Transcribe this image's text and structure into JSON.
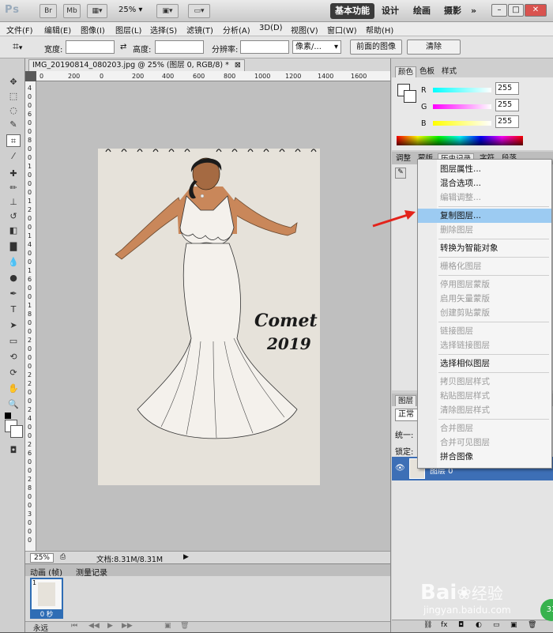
{
  "app": {
    "logo": "Ps",
    "launcher_br": "Br",
    "launcher_mb": "Mb",
    "zoom_select": "25%",
    "workspaces": [
      "基本功能",
      "设计",
      "绘画",
      "摄影"
    ],
    "more": "»"
  },
  "menu": [
    "文件(F)",
    "编辑(E)",
    "图像(I)",
    "图层(L)",
    "选择(S)",
    "滤镜(T)",
    "分析(A)",
    "3D(D)",
    "视图(V)",
    "窗口(W)",
    "帮助(H)"
  ],
  "options": {
    "width_label": "宽度:",
    "swap": "⇄",
    "height_label": "高度:",
    "resolution_label": "分辨率:",
    "unit_select": "像素/...",
    "front_image_button": "前面的图像",
    "clear_button": "清除"
  },
  "document": {
    "tab_title": "IMG_20190814_080203.jpg @ 25% (图层 0, RGB/8) *",
    "ruler_h": [
      "0",
      "200",
      "0",
      "200",
      "400",
      "600",
      "800",
      "1000",
      "1200",
      "1400",
      "1600"
    ],
    "ruler_v": [
      "4",
      "0",
      "0",
      "6",
      "0",
      "0",
      "8",
      "0",
      "0",
      "1",
      "0",
      "0",
      "0",
      "1",
      "2",
      "0",
      "0",
      "1",
      "4",
      "0",
      "0",
      "1",
      "6",
      "0",
      "0",
      "1",
      "8",
      "0",
      "0",
      "2",
      "0",
      "0",
      "0",
      "2",
      "2",
      "0",
      "0",
      "2",
      "4",
      "0",
      "0",
      "2",
      "6",
      "0",
      "0",
      "2",
      "8",
      "0",
      "0",
      "3",
      "0",
      "0",
      "0"
    ],
    "artwork_text_line1": "Comet",
    "artwork_text_line2": "2019",
    "status_zoom": "25%",
    "status_doc": "文档:8.31M/8.31M"
  },
  "animation": {
    "tabs": [
      "动画 (帧)",
      "测量记录"
    ],
    "frame_index": "1",
    "frame_delay": "0 秒",
    "loop": "永远"
  },
  "color_panel": {
    "tabs": [
      "颜色",
      "色板",
      "样式"
    ],
    "channels": [
      {
        "label": "R",
        "value": "255",
        "gradient": "#ff0000"
      },
      {
        "label": "G",
        "value": "255",
        "gradient": "#00ff00"
      },
      {
        "label": "B",
        "value": "255",
        "gradient": "#0000ff"
      }
    ]
  },
  "history_panel": {
    "tabs": [
      "调整",
      "蒙版",
      "历史记录",
      "字符",
      "段落"
    ]
  },
  "layers_panel": {
    "tabs": [
      "图层"
    ],
    "blend_mode": "正常",
    "unify_label": "统一:",
    "lock_label": "锁定:",
    "layer_name": "图层 0"
  },
  "context_menu": {
    "groups": [
      [
        {
          "label": "图层属性...",
          "enabled": true
        },
        {
          "label": "混合选项...",
          "enabled": true
        },
        {
          "label": "编辑调整...",
          "enabled": false
        }
      ],
      [
        {
          "label": "复制图层...",
          "enabled": true,
          "highlighted": true
        },
        {
          "label": "删除图层",
          "enabled": false
        }
      ],
      [
        {
          "label": "转换为智能对象",
          "enabled": true
        }
      ],
      [
        {
          "label": "栅格化图层",
          "enabled": false
        }
      ],
      [
        {
          "label": "停用图层蒙版",
          "enabled": false
        },
        {
          "label": "启用矢量蒙版",
          "enabled": false
        },
        {
          "label": "创建剪贴蒙版",
          "enabled": false
        }
      ],
      [
        {
          "label": "链接图层",
          "enabled": false
        },
        {
          "label": "选择链接图层",
          "enabled": false
        }
      ],
      [
        {
          "label": "选择相似图层",
          "enabled": true
        }
      ],
      [
        {
          "label": "拷贝图层样式",
          "enabled": false
        },
        {
          "label": "粘贴图层样式",
          "enabled": false
        },
        {
          "label": "清除图层样式",
          "enabled": false
        }
      ],
      [
        {
          "label": "合并图层",
          "enabled": false
        },
        {
          "label": "合并可见图层",
          "enabled": false
        },
        {
          "label": "拼合图像",
          "enabled": true
        }
      ]
    ]
  },
  "watermark": {
    "brand": "Bai",
    "brand_suffix": "经验",
    "url": "jingyan.baidu.com",
    "badge": "33"
  }
}
